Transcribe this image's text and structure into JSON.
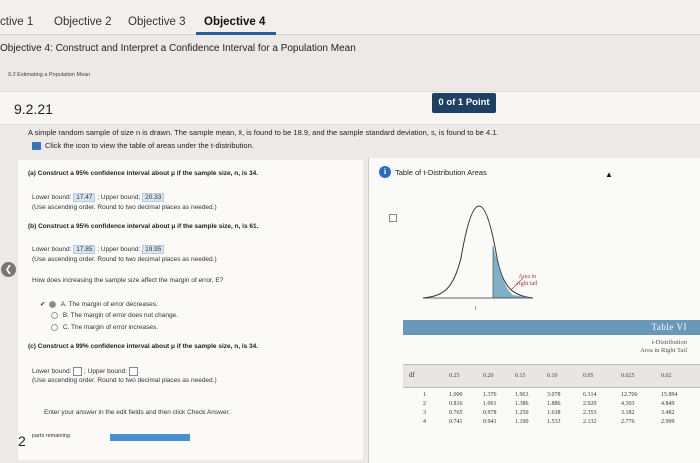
{
  "tabs": [
    {
      "label": "ctive 1"
    },
    {
      "label": "Objective 2"
    },
    {
      "label": "Objective 3"
    },
    {
      "label": "Objective 4"
    }
  ],
  "objective_title": "Objective 4: Construct and Interpret a Confidence Interval for a Population Mean",
  "section_subtitle": "9.2 Estimating a Population Mean",
  "question": {
    "number": "9.2.21",
    "points": "0 of 1 Point",
    "prompt": "A simple random sample of size n is drawn. The sample mean, x̄, is found to be 18.9, and the sample standard deviation, s, is found to be 4.1.",
    "table_link": "Click the icon to view the table of areas under the t-distribution."
  },
  "part_a": {
    "text": "(a) Construct a 95% confidence interval about μ if the sample size, n, is 34.",
    "lower_label": "Lower bound:",
    "lower_value": "17.47",
    "upper_label": "; Upper bound:",
    "upper_value": "20.33",
    "hint": "(Use ascending order. Round to two decimal places as needed.)"
  },
  "part_b": {
    "text": "(b) Construct a 95% confidence interval about μ if the sample size, n, is 61.",
    "lower_label": "Lower bound:",
    "lower_value": "17.85",
    "upper_label": "; Upper bound:",
    "upper_value": "19.95",
    "hint": "(Use ascending order. Round to two decimal places as needed.)",
    "question": "How does increasing the sample size affect the margin of error, E?",
    "options": [
      {
        "label": "A.",
        "text": "The margin of error decreases."
      },
      {
        "label": "B.",
        "text": "The margin of error does not change."
      },
      {
        "label": "C.",
        "text": "The margin of error increases."
      }
    ]
  },
  "part_c": {
    "text": "(c) Construct a 99% confidence interval about μ if the sample size, n, is 34.",
    "lower_label": "Lower bound:",
    "upper_label": "; Upper bound:",
    "hint": "(Use ascending order. Round to two decimal places as needed.)"
  },
  "footer": {
    "instruction": "Enter your answer in the edit fields and then click Check Answer.",
    "parts_count": "2",
    "parts_label": "parts remaining"
  },
  "popup": {
    "title": "Table of t-Distribution Areas",
    "area_label_1": "Area in",
    "area_label_2": "right tail",
    "t_label": "t",
    "table_title": "Table VI",
    "caption_1": "t-Distribution",
    "caption_2": "Area in Right Tail",
    "df_label": "df",
    "columns": [
      "0.25",
      "0.20",
      "0.15",
      "0.10",
      "0.05",
      "0.025",
      "0.02"
    ],
    "rows": [
      {
        "df": "1",
        "values": [
          "1.000",
          "1.376",
          "1.963",
          "3.078",
          "6.314",
          "12.706",
          "15.894"
        ]
      },
      {
        "df": "2",
        "values": [
          "0.816",
          "1.061",
          "1.386",
          "1.886",
          "2.920",
          "4.303",
          "4.849"
        ]
      },
      {
        "df": "3",
        "values": [
          "0.765",
          "0.978",
          "1.250",
          "1.638",
          "2.353",
          "3.182",
          "3.482"
        ]
      },
      {
        "df": "4",
        "values": [
          "0.741",
          "0.941",
          "1.190",
          "1.533",
          "2.132",
          "2.776",
          "2.999"
        ]
      }
    ]
  },
  "colors": {
    "accent": "#2a5c98",
    "points_badge": "#1f3f63",
    "table_header": "#6a98b8",
    "tail_fill": "#7fb0c8",
    "progress": "#4a90d0"
  }
}
